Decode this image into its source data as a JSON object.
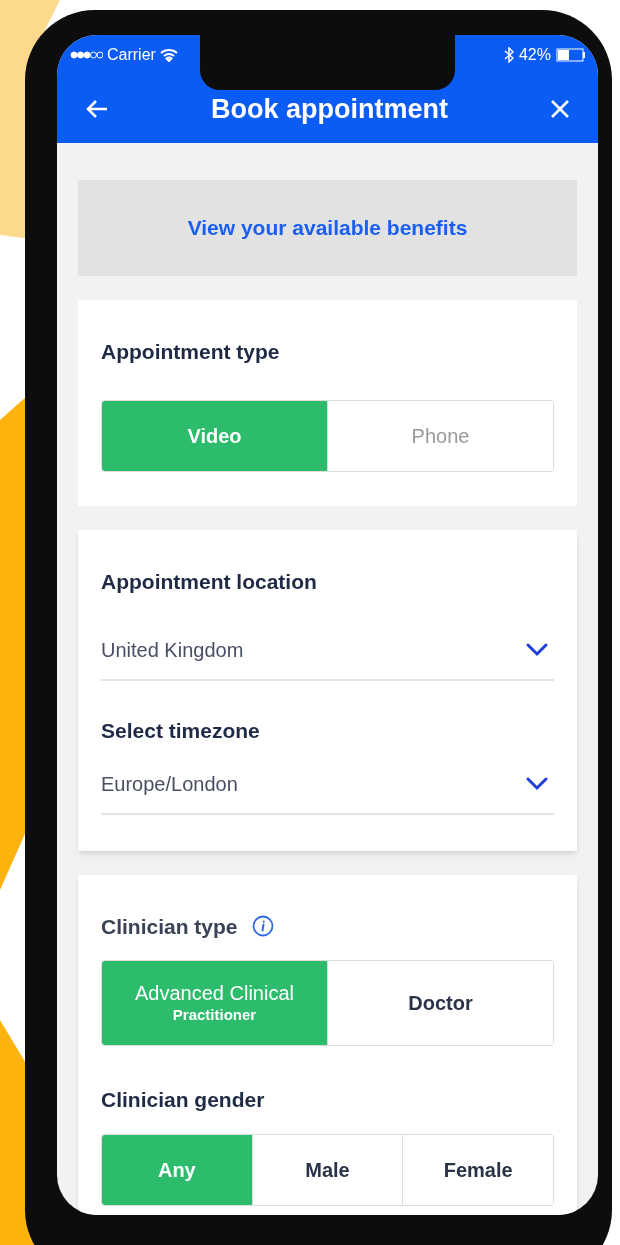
{
  "status_bar": {
    "carrier": "Carrier",
    "battery": "42%"
  },
  "header": {
    "title": "Book appointment"
  },
  "benefits_link": "View your available benefits",
  "appointment_type": {
    "label": "Appointment type",
    "options": [
      {
        "label": "Video",
        "selected": true
      },
      {
        "label": "Phone",
        "selected": false
      }
    ]
  },
  "location": {
    "label": "Appointment location",
    "value": "United Kingdom"
  },
  "timezone": {
    "label": "Select timezone",
    "value": "Europe/London"
  },
  "clinician_type": {
    "label": "Clinician type",
    "options": [
      {
        "label": "Advanced Clinical",
        "sublabel": "Practitioner",
        "selected": true
      },
      {
        "label": "Doctor",
        "selected": false
      }
    ]
  },
  "clinician_gender": {
    "label": "Clinician gender",
    "options": [
      {
        "label": "Any",
        "selected": true
      },
      {
        "label": "Male",
        "selected": false
      },
      {
        "label": "Female",
        "selected": false
      }
    ]
  }
}
